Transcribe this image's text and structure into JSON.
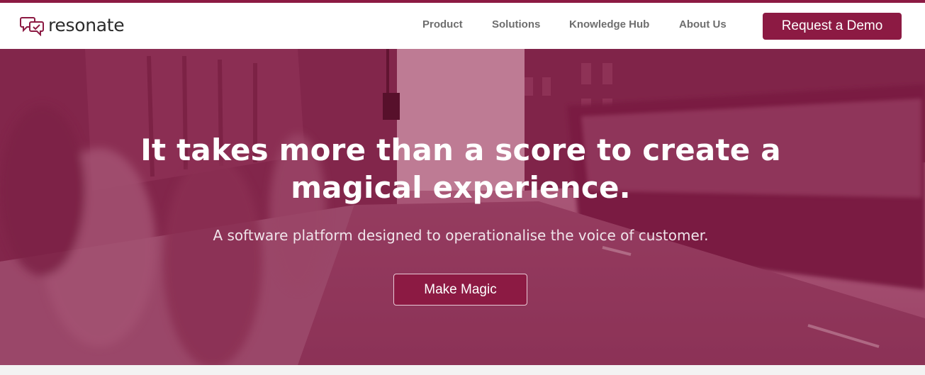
{
  "brand": {
    "name": "resonate",
    "logo_icon": "speech-bubbles-icon",
    "accent_color": "#8c1a43"
  },
  "nav": {
    "items": [
      {
        "label": "Product"
      },
      {
        "label": "Solutions"
      },
      {
        "label": "Knowledge Hub"
      },
      {
        "label": "About Us"
      }
    ],
    "cta_label": "Request a Demo"
  },
  "hero": {
    "title": "It takes more than a score to create a magical experience.",
    "subtitle": "A software platform designed to operationalise the voice of customer.",
    "cta_label": "Make Magic",
    "overlay_color": "#8c1a43"
  }
}
